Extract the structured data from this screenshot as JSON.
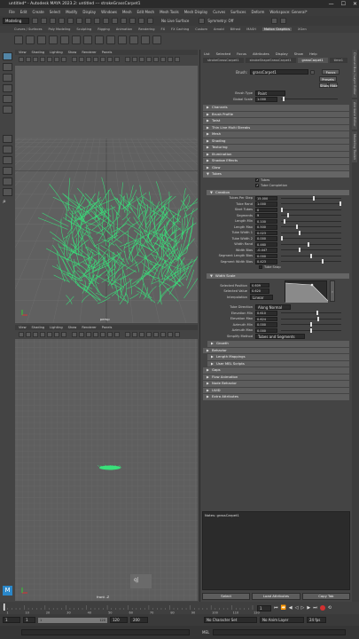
{
  "window": {
    "title": "untitled* - Autodesk MAYA 2023.2: untitled --- strokeGrassCarpet1",
    "min": "—",
    "max": "☐",
    "close": "✕"
  },
  "menubar": [
    "File",
    "Edit",
    "Create",
    "Select",
    "Modify",
    "Display",
    "Windows",
    "Mesh",
    "Edit Mesh",
    "Mesh Tools",
    "Mesh Display",
    "Curves",
    "Surfaces",
    "Deform",
    "Workspace: General*"
  ],
  "status": {
    "mode": "Modeling",
    "live_surface": "No Live Surface",
    "symmetry": "Symmetry: Off"
  },
  "shelf_tabs": [
    "Curves / Surfaces",
    "Poly Modeling",
    "Sculpting",
    "Rigging",
    "Animation",
    "Rendering",
    "FX",
    "FX Caching",
    "Custom",
    "Arnold",
    "Bifrost",
    "MASH",
    "Motion Graphics",
    "XGen"
  ],
  "shelf_active": "Motion Graphics",
  "viewport_menu": [
    "View",
    "Shading",
    "Lighting",
    "Show",
    "Renderer",
    "Panels"
  ],
  "viewport_top_label": "persp",
  "viewport_bottom_label": "front -Z",
  "viewport_bottom_text": "q|",
  "ae": {
    "menu": [
      "List",
      "Selected",
      "Focus",
      "Attributes",
      "Display",
      "Show",
      "Help"
    ],
    "tabs": [
      "strokeGrassCarpet1",
      "strokeShapeGrassCarpet1",
      "grassCarpet1",
      "time1"
    ],
    "active_tab": "grassCarpet1",
    "brush_label": "Brush:",
    "brush_value": "grassCarpet1",
    "focus_btn": "Focus",
    "presets_btn": "Presets",
    "show_btn": "Show",
    "hide_btn": "Hide",
    "brush_type_label": "Brush Type",
    "brush_type_value": "Paint",
    "global_scale_label": "Global Scale",
    "global_scale_value": "1.000",
    "closed_frames": [
      "Channels",
      "Brush Profile",
      "Twist",
      "Thin Line Multi Streaks",
      "Mesh",
      "Shading",
      "Texturing",
      "Illumination",
      "Shadow Effects",
      "Glow"
    ],
    "tubes_label": "Tubes",
    "tubes_check": "Tubes",
    "tube_completion_check": "Tube Completion",
    "creation_label": "Creation",
    "creation_attrs": [
      {
        "label": "Tubes Per Step",
        "value": "15.000"
      },
      {
        "label": "Tube Rand",
        "value": "1.000"
      },
      {
        "label": "Start Tubes",
        "value": "0"
      },
      {
        "label": "Segments",
        "value": "9"
      },
      {
        "label": "Length Min",
        "value": "0.100"
      },
      {
        "label": "Length Max",
        "value": "0.500"
      },
      {
        "label": "Tube Width 1",
        "value": "0.023"
      },
      {
        "label": "Tube Width 2",
        "value": "0.000"
      },
      {
        "label": "Width Rand",
        "value": "0.460"
      },
      {
        "label": "Width Bias",
        "value": "-0.447"
      },
      {
        "label": "Segment Length Bias",
        "value": "0.000"
      },
      {
        "label": "Segment Width Bias",
        "value": "0.423"
      }
    ],
    "creation_knobs": [
      0.55,
      1.0,
      0.0,
      0.1,
      0.05,
      0.25,
      0.3,
      0.0,
      0.46,
      0.3,
      0.5,
      0.7
    ],
    "path_snap_label": "Tube Snap",
    "width_scale_label": "Width Scale",
    "selected_position_label": "Selected Position",
    "selected_position_value": "0.609",
    "selected_value_label": "Selected Value",
    "selected_value_value": "0.620",
    "interpolation_label": "Interpolation",
    "interpolation_value": "Linear",
    "tube_direction_label": "Tube Direction",
    "tube_direction_value": "Along Normal",
    "direction_attrs": [
      {
        "label": "Elevation Min",
        "value": "0.610"
      },
      {
        "label": "Elevation Max",
        "value": "0.624"
      },
      {
        "label": "Azimuth Min",
        "value": "0.000"
      },
      {
        "label": "Azimuth Max",
        "value": "0.000"
      }
    ],
    "direction_knobs": [
      0.6,
      0.62,
      0.5,
      0.5
    ],
    "simplify_label": "Simplify Method",
    "simplify_value": "Tubes and Segments",
    "lower_frames": [
      "Growth",
      "Behavior",
      "Length Mappings",
      "User MEL Scripts",
      "Gaps",
      "Flow Animation",
      "Node Behavior",
      "UUID",
      "Extra Attributes"
    ],
    "lower_indent": [
      true,
      false,
      true,
      true,
      false,
      false,
      false,
      false,
      false
    ],
    "notes_label": "Notes:  grassCarpet1",
    "select_btn": "Select",
    "load_btn": "Load Attributes",
    "copy_btn": "Copy Tab"
  },
  "side_tabs": [
    "Channel Box / Layer Editor",
    "Attribute Editor",
    "Modeling Toolkit"
  ],
  "timeline": {
    "ticks": [
      "1",
      "10",
      "20",
      "30",
      "40",
      "50",
      "60",
      "70",
      "80",
      "90",
      "100",
      "110",
      "120"
    ],
    "current_frame": "1",
    "range_start": "1",
    "range_inner_start": "1",
    "range_inner_end": "120",
    "range_end_a": "120",
    "range_end_b": "200",
    "character_set": "No Character Set",
    "anim_layer": "No Anim Layer",
    "fps": "24 fps"
  },
  "cmdline": {
    "lang": "MEL"
  },
  "colors": {
    "grass": "#39e07a",
    "accent": "#5285a6",
    "record": "#d33030"
  }
}
